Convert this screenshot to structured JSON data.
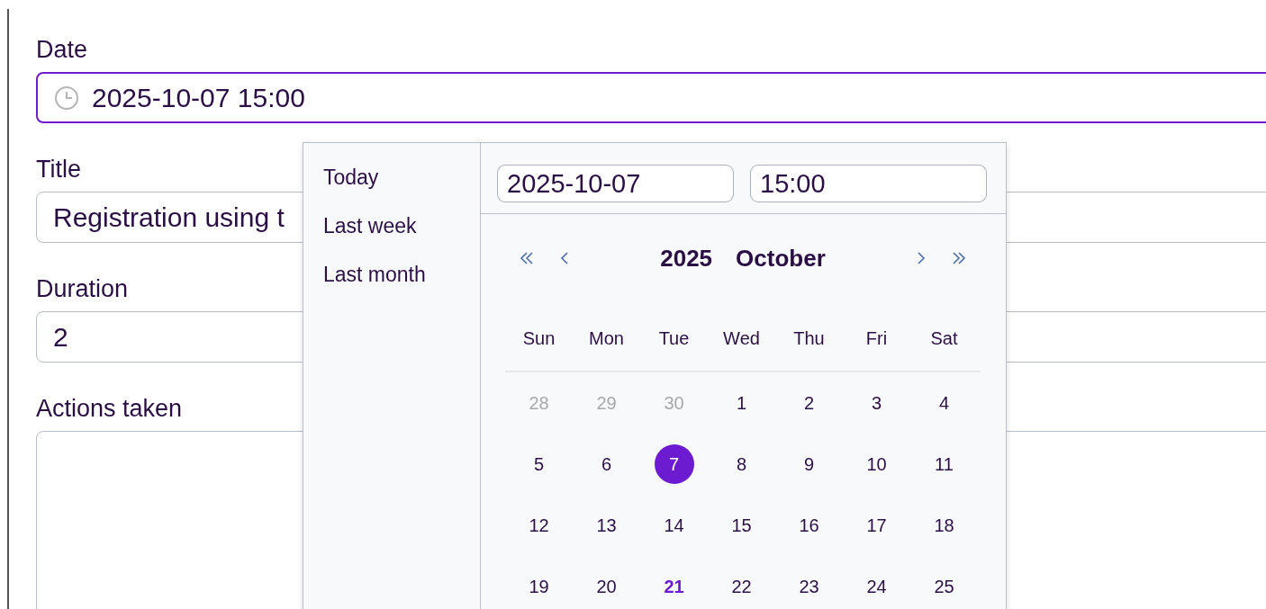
{
  "form": {
    "fields": [
      {
        "label": "Date",
        "kind": "datetime",
        "value": "2025-10-07 15:00",
        "focused": true
      },
      {
        "label": "Title",
        "kind": "text",
        "value": "Registration using t",
        "focused": false
      },
      {
        "label": "Duration",
        "kind": "text",
        "value": "2",
        "focused": false
      },
      {
        "label": "Actions taken",
        "kind": "textarea",
        "focused": false
      }
    ]
  },
  "picker": {
    "shortcuts": [
      "Today",
      "Last week",
      "Last month"
    ],
    "date_input": "2025-10-07",
    "time_input": "15:00",
    "year": "2025",
    "month": "October",
    "weekdays": [
      "Sun",
      "Mon",
      "Tue",
      "Wed",
      "Thu",
      "Fri",
      "Sat"
    ],
    "weeks": [
      [
        {
          "day": "28",
          "kind": "outside",
          "selected": false
        },
        {
          "day": "29",
          "kind": "outside",
          "selected": false
        },
        {
          "day": "30",
          "kind": "outside",
          "selected": false
        },
        {
          "day": "1",
          "kind": "current",
          "selected": false
        },
        {
          "day": "2",
          "kind": "current",
          "selected": false
        },
        {
          "day": "3",
          "kind": "current",
          "selected": false
        },
        {
          "day": "4",
          "kind": "current",
          "selected": false
        }
      ],
      [
        {
          "day": "5",
          "kind": "current",
          "selected": false
        },
        {
          "day": "6",
          "kind": "current",
          "selected": false
        },
        {
          "day": "7",
          "kind": "current",
          "selected": true
        },
        {
          "day": "8",
          "kind": "current",
          "selected": false
        },
        {
          "day": "9",
          "kind": "current",
          "selected": false
        },
        {
          "day": "10",
          "kind": "current",
          "selected": false
        },
        {
          "day": "11",
          "kind": "current",
          "selected": false
        }
      ],
      [
        {
          "day": "12",
          "kind": "current",
          "selected": false
        },
        {
          "day": "13",
          "kind": "current",
          "selected": false
        },
        {
          "day": "14",
          "kind": "current",
          "selected": false
        },
        {
          "day": "15",
          "kind": "current",
          "selected": false
        },
        {
          "day": "16",
          "kind": "current",
          "selected": false
        },
        {
          "day": "17",
          "kind": "current",
          "selected": false
        },
        {
          "day": "18",
          "kind": "current",
          "selected": false
        }
      ],
      [
        {
          "day": "19",
          "kind": "current",
          "selected": false
        },
        {
          "day": "20",
          "kind": "current",
          "selected": false
        },
        {
          "day": "21",
          "kind": "today",
          "selected": false
        },
        {
          "day": "22",
          "kind": "current",
          "selected": false
        },
        {
          "day": "23",
          "kind": "current",
          "selected": false
        },
        {
          "day": "24",
          "kind": "current",
          "selected": false
        },
        {
          "day": "25",
          "kind": "current",
          "selected": false
        }
      ]
    ]
  }
}
